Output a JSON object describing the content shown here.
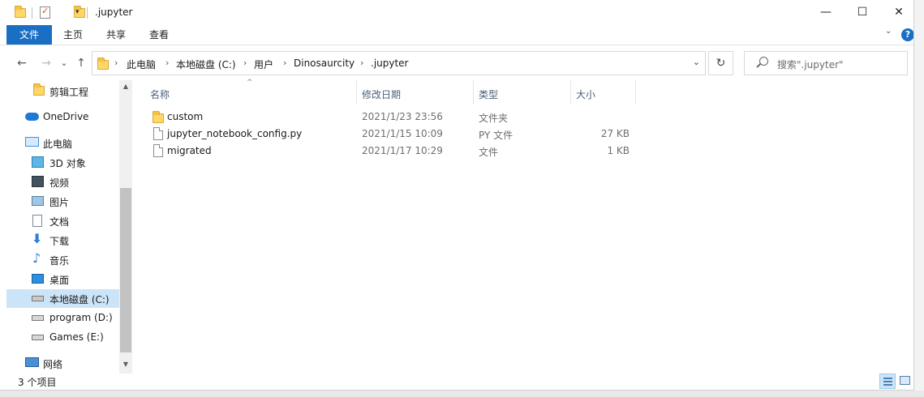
{
  "window": {
    "title": ".jupyter",
    "controls": {
      "minimize": "—",
      "maximize": "☐",
      "close": "✕"
    }
  },
  "ribbon": {
    "tabs": [
      {
        "label": "文件",
        "active": true
      },
      {
        "label": "主页"
      },
      {
        "label": "共享"
      },
      {
        "label": "查看"
      }
    ],
    "help": "?"
  },
  "nav": {
    "back": "←",
    "forward": "→",
    "recent": "⌄",
    "up": "↑",
    "breadcrumb": [
      "此电脑",
      "本地磁盘 (C:)",
      "用户",
      "Dinosaurcity",
      ".jupyter"
    ],
    "refresh": "↻",
    "search_placeholder": "搜索\".jupyter\""
  },
  "sidebar": {
    "items": [
      {
        "label": "剪辑工程",
        "icon": "folder-icon"
      },
      {
        "label": "OneDrive",
        "icon": "cloud-icon"
      },
      {
        "label": "此电脑",
        "icon": "computer-icon"
      },
      {
        "label": "3D 对象",
        "icon": "3d-objects-icon"
      },
      {
        "label": "视频",
        "icon": "video-icon"
      },
      {
        "label": "图片",
        "icon": "pictures-icon"
      },
      {
        "label": "文档",
        "icon": "documents-icon"
      },
      {
        "label": "下载",
        "icon": "download-icon"
      },
      {
        "label": "音乐",
        "icon": "music-icon"
      },
      {
        "label": "桌面",
        "icon": "desktop-icon"
      },
      {
        "label": "本地磁盘 (C:)",
        "icon": "drive-c-icon",
        "selected": true
      },
      {
        "label": "program (D:)",
        "icon": "drive-icon"
      },
      {
        "label": "Games (E:)",
        "icon": "drive-icon"
      },
      {
        "label": "网络",
        "icon": "network-icon"
      }
    ]
  },
  "columns": {
    "name": "名称",
    "date": "修改日期",
    "type": "类型",
    "size": "大小"
  },
  "files": [
    {
      "name": "custom",
      "date": "2021/1/23 23:56",
      "type": "文件夹",
      "size": "",
      "icon": "folder-icon"
    },
    {
      "name": "jupyter_notebook_config.py",
      "date": "2021/1/15 10:09",
      "type": "PY 文件",
      "size": "27 KB",
      "icon": "file-icon"
    },
    {
      "name": "migrated",
      "date": "2021/1/17 10:29",
      "type": "文件",
      "size": "1 KB",
      "icon": "file-icon"
    }
  ],
  "status": {
    "count": "3 个项目"
  },
  "colors": {
    "accent": "#1a6fc4",
    "selection": "#cce4f7",
    "header_text": "#4c607a"
  }
}
